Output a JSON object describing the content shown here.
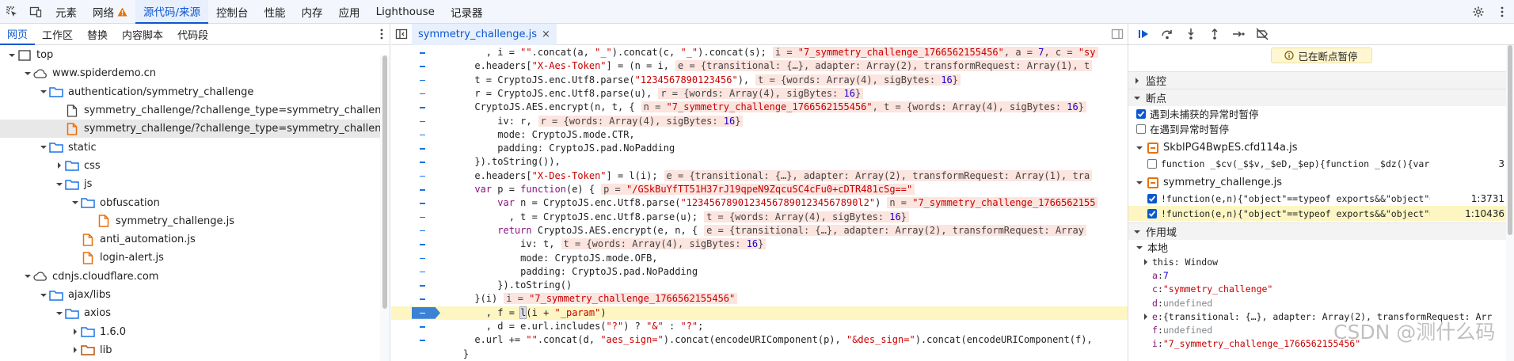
{
  "toolbar": {
    "tabs": [
      "元素",
      "网络",
      "源代码/来源",
      "控制台",
      "性能",
      "内存",
      "应用",
      "Lighthouse",
      "记录器"
    ],
    "active_tab": "源代码/来源",
    "warning_tab": "网络"
  },
  "navigator": {
    "tabs": [
      "网页",
      "工作区",
      "替换",
      "内容脚本",
      "代码段"
    ],
    "active_tab": "网页",
    "tree": [
      {
        "label": "top",
        "depth": 0,
        "expanded": true,
        "icon": "frame-icon"
      },
      {
        "label": "www.spiderdemo.cn",
        "depth": 1,
        "expanded": true,
        "icon": "cloud-icon"
      },
      {
        "label": "authentication/symmetry_challenge",
        "depth": 2,
        "expanded": true,
        "icon": "folder-icon"
      },
      {
        "label": "symmetry_challenge/?challenge_type=symmetry_challenge",
        "depth": 3,
        "icon": "doc-icon"
      },
      {
        "label": "symmetry_challenge/?challenge_type=symmetry_challenge",
        "depth": 3,
        "icon": "js-file-icon",
        "selected": true
      },
      {
        "label": "static",
        "depth": 2,
        "expanded": true,
        "icon": "folder-icon"
      },
      {
        "label": "css",
        "depth": 3,
        "expanded": false,
        "icon": "folder-icon"
      },
      {
        "label": "js",
        "depth": 3,
        "expanded": true,
        "icon": "folder-icon"
      },
      {
        "label": "obfuscation",
        "depth": 4,
        "expanded": true,
        "icon": "folder-icon"
      },
      {
        "label": "symmetry_challenge.js",
        "depth": 5,
        "icon": "js-file-icon"
      },
      {
        "label": "anti_automation.js",
        "depth": 4,
        "icon": "js-file-icon"
      },
      {
        "label": "login-alert.js",
        "depth": 4,
        "icon": "js-file-icon"
      },
      {
        "label": "cdnjs.cloudflare.com",
        "depth": 1,
        "expanded": true,
        "icon": "cloud-icon"
      },
      {
        "label": "ajax/libs",
        "depth": 2,
        "expanded": true,
        "icon": "folder-icon"
      },
      {
        "label": "axios",
        "depth": 3,
        "expanded": true,
        "icon": "folder-icon"
      },
      {
        "label": "1.6.0",
        "depth": 4,
        "expanded": false,
        "icon": "folder-icon"
      },
      {
        "label": "lib",
        "depth": 4,
        "expanded": false,
        "icon": "folder-brown-icon"
      }
    ]
  },
  "editor": {
    "file_tab": "symmetry_challenge.js",
    "close": "×"
  },
  "debugger": {
    "paused_label": "已在断点暂停",
    "sections": {
      "watch": "监控",
      "breakpoints": "断点",
      "scope": "作用域",
      "local": "本地"
    },
    "exception_options": [
      {
        "label": "遇到未捕获的异常时暂停",
        "checked": true
      },
      {
        "label": "在遇到异常时暂停",
        "checked": false
      }
    ],
    "bp_files": [
      {
        "name": "SkblPG4BwpES.cfd114a.js",
        "items": [
          {
            "code": "function _$cv(_$$v,_$eD,_$ep){function _$dz(){var _$_q=[…",
            "line": "3",
            "checked": false,
            "highlight": false
          }
        ]
      },
      {
        "name": "symmetry_challenge.js",
        "items": [
          {
            "code": "!function(e,n){\"object\"==typeof exports&&\"object\"==t…",
            "line": "1:3731",
            "checked": true,
            "highlight": false
          },
          {
            "code": "!function(e,n){\"object\"==typeof exports&&\"object\"==…",
            "line": "1:10436",
            "checked": true,
            "highlight": true
          }
        ]
      }
    ],
    "scope_this": "this: Window",
    "scope_vars": [
      {
        "k": "a",
        "v": "7",
        "type": "num"
      },
      {
        "k": "c",
        "v": "\"symmetry_challenge\"",
        "type": "str"
      },
      {
        "k": "d",
        "v": "undefined",
        "type": "undef"
      },
      {
        "k": "e",
        "v": "{transitional: {…}, adapter: Array(2), transformRequest: Arr",
        "type": "obj",
        "expandable": true
      },
      {
        "k": "f",
        "v": "undefined",
        "type": "undef"
      },
      {
        "k": "i",
        "v": "\"7_symmetry_challenge_1766562155456\"",
        "type": "str"
      }
    ]
  },
  "watermark": "CSDN @测什么码"
}
